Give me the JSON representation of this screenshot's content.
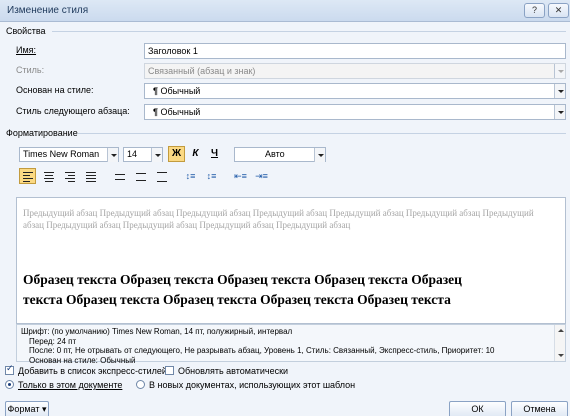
{
  "window": {
    "title": "Изменение стиля",
    "help": "?",
    "close": "✕"
  },
  "properties": {
    "header": "Свойства",
    "name_label": "Имя:",
    "name_value": "Заголовок 1",
    "type_label": "Стиль:",
    "type_value": "Связанный (абзац и знак)",
    "based_label": "Основан на стиле:",
    "based_value": "Обычный",
    "next_label": "Стиль следующего абзаца:",
    "next_value": "Обычный",
    "para_mark": "¶"
  },
  "formatting": {
    "header": "Форматирование",
    "font": "Times New Roman",
    "size": "14",
    "bold": "Ж",
    "italic": "К",
    "underline": "Ч",
    "color": "Авто"
  },
  "preview": {
    "previous_text": "Предыдущий абзац Предыдущий абзац Предыдущий абзац Предыдущий абзац Предыдущий абзац Предыдущий абзац Предыдущий абзац Предыдущий абзац Предыдущий абзац Предыдущий абзац Предыдущий абзац",
    "sample_line1": "Образец текста Образец текста Образец текста Образец текста Образец",
    "sample_line2": "текста Образец текста Образец текста Образец текста Образец текста"
  },
  "description": {
    "line1": "Шрифт: (по умолчанию) Times New Roman, 14 пт, полужирный, интервал",
    "line2": "Перед:  24 пт",
    "line3": "После:  0 пт, Не отрывать от следующего, Не разрывать абзац, Уровень 1, Стиль: Связанный, Экспресс-стиль, Приоритет: 10",
    "line4": "Основан на стиле: Обычный"
  },
  "options": {
    "add_to_gallery": "Добавить в список экспресс-стилей",
    "auto_update": "Обновлять автоматически",
    "this_document": "Только в этом документе",
    "new_documents": "В новых документах, использующих этот шаблон"
  },
  "buttons": {
    "format": "Формат ▾",
    "ok": "ОК",
    "cancel": "Отмена"
  }
}
